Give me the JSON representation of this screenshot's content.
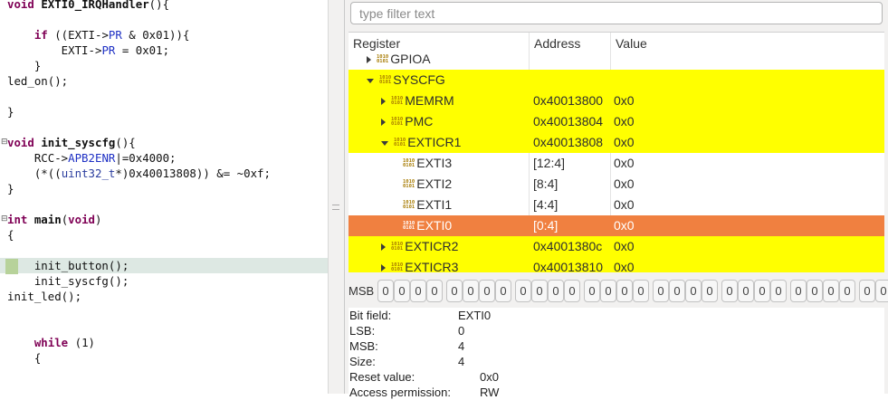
{
  "editor": {
    "lines": [
      {
        "segments": [
          {
            "t": "void ",
            "c": "kw"
          },
          {
            "t": "EXTI0_IRQHandler",
            "c": "fn"
          },
          {
            "t": "(){"
          }
        ]
      },
      {
        "segments": []
      },
      {
        "segments": [
          {
            "t": "    "
          },
          {
            "t": "if",
            "c": "kw"
          },
          {
            "t": " ((EXTI->"
          },
          {
            "t": "PR",
            "c": "fd"
          },
          {
            "t": " & 0x01)){"
          }
        ]
      },
      {
        "segments": [
          {
            "t": "        EXTI->"
          },
          {
            "t": "PR",
            "c": "fd"
          },
          {
            "t": " = 0x01;"
          }
        ]
      },
      {
        "segments": [
          {
            "t": "    }"
          }
        ]
      },
      {
        "segments": [
          {
            "t": "led_on();"
          }
        ]
      },
      {
        "segments": []
      },
      {
        "segments": [
          {
            "t": "}"
          }
        ]
      },
      {
        "segments": []
      },
      {
        "segments": [
          {
            "t": "void ",
            "c": "kw"
          },
          {
            "t": "init_syscfg",
            "c": "fn"
          },
          {
            "t": "(){"
          }
        ]
      },
      {
        "segments": [
          {
            "t": "    RCC->"
          },
          {
            "t": "APB2ENR",
            "c": "fd"
          },
          {
            "t": "|=0x4000;"
          }
        ]
      },
      {
        "segments": [
          {
            "t": "    (*(("
          },
          {
            "t": "uint32_t",
            "c": "ty"
          },
          {
            "t": "*)0x40013808)) &= ~0xf;"
          }
        ]
      },
      {
        "segments": [
          {
            "t": "}"
          }
        ]
      },
      {
        "segments": []
      },
      {
        "segments": [
          {
            "t": "int ",
            "c": "kw"
          },
          {
            "t": "main",
            "c": "fn"
          },
          {
            "t": "("
          },
          {
            "t": "void",
            "c": "kw"
          },
          {
            "t": ")"
          }
        ]
      },
      {
        "segments": [
          {
            "t": "{"
          }
        ]
      },
      {
        "segments": []
      },
      {
        "segments": [
          {
            "t": "    init_button();"
          }
        ]
      },
      {
        "segments": [
          {
            "t": "    init_syscfg();"
          }
        ]
      },
      {
        "segments": [
          {
            "t": "init_led();"
          }
        ]
      },
      {
        "segments": []
      },
      {
        "segments": []
      },
      {
        "segments": [
          {
            "t": "    "
          },
          {
            "t": "while",
            "c": "kw"
          },
          {
            "t": " (1)"
          }
        ]
      },
      {
        "segments": [
          {
            "t": "    {"
          }
        ]
      }
    ],
    "current_line_index": 17,
    "fold_marker_lines": [
      9,
      14
    ]
  },
  "registers": {
    "filter_placeholder": "type filter text",
    "filter_value": "",
    "columns": [
      "Register",
      "Address",
      "Value"
    ],
    "rows": [
      {
        "indent": 1,
        "twisty": "right",
        "name": "GPIOA",
        "address": "",
        "value": "",
        "style": "plain"
      },
      {
        "indent": 1,
        "twisty": "down",
        "name": "SYSCFG",
        "address": "",
        "value": "",
        "style": "yellow"
      },
      {
        "indent": 2,
        "twisty": "right",
        "name": "MEMRM",
        "address": "0x40013800",
        "value": "0x0",
        "style": "yellow"
      },
      {
        "indent": 2,
        "twisty": "right",
        "name": "PMC",
        "address": "0x40013804",
        "value": "0x0",
        "style": "yellow"
      },
      {
        "indent": 2,
        "twisty": "down",
        "name": "EXTICR1",
        "address": "0x40013808",
        "value": "0x0",
        "style": "yellow"
      },
      {
        "indent": 3,
        "twisty": "none",
        "name": "EXTI3",
        "address": "[12:4]",
        "value": "0x0",
        "style": "plain"
      },
      {
        "indent": 3,
        "twisty": "none",
        "name": "EXTI2",
        "address": "[8:4]",
        "value": "0x0",
        "style": "plain"
      },
      {
        "indent": 3,
        "twisty": "none",
        "name": "EXTI1",
        "address": "[4:4]",
        "value": "0x0",
        "style": "plain"
      },
      {
        "indent": 3,
        "twisty": "none",
        "name": "EXTI0",
        "address": "[0:4]",
        "value": "0x0",
        "style": "selected"
      },
      {
        "indent": 2,
        "twisty": "right",
        "name": "EXTICR2",
        "address": "0x4001380c",
        "value": "0x0",
        "style": "yellow"
      },
      {
        "indent": 2,
        "twisty": "right",
        "name": "EXTICR3",
        "address": "0x40013810",
        "value": "0x0",
        "style": "yellow"
      }
    ],
    "bit_icon": "binary-register-icon"
  },
  "bits": {
    "label": "MSB",
    "values": [
      "0",
      "0",
      "0",
      "0",
      "0",
      "0",
      "0",
      "0",
      "0",
      "0",
      "0",
      "0",
      "0",
      "0",
      "0",
      "0",
      "0",
      "0",
      "0",
      "0",
      "0",
      "0",
      "0",
      "0",
      "0",
      "0",
      "0",
      "0",
      "0",
      "0",
      "0",
      "0"
    ]
  },
  "details": {
    "bit_field_label": "Bit field:",
    "bit_field_value": "EXTI0",
    "lsb_label": "LSB:",
    "lsb_value": "0",
    "msb_label": "MSB:",
    "msb_value": "4",
    "size_label": "Size:",
    "size_value": "4",
    "reset_label": "Reset value:",
    "reset_value": "0x0",
    "access_label": "Access permission:",
    "access_value": "RW"
  },
  "colors": {
    "highlight": "#ffff00",
    "selection": "#f08040",
    "keyword": "#7f0055"
  }
}
